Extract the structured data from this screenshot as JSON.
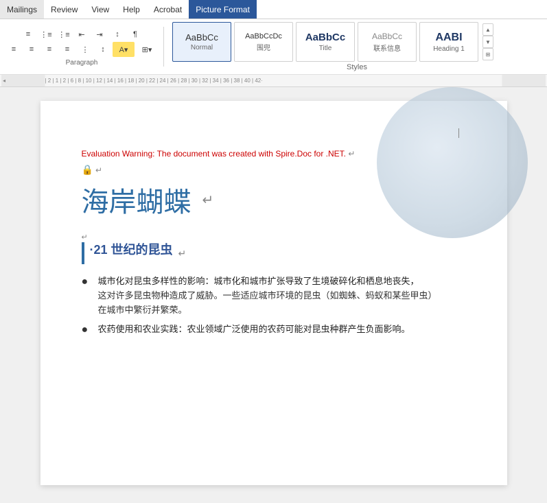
{
  "menu": {
    "items": [
      "Mailings",
      "Review",
      "View",
      "Help",
      "Acrobat",
      "Picture Format"
    ]
  },
  "toolbar": {
    "paragraph_label": "Paragraph",
    "styles_label": "Styles",
    "styles": [
      {
        "id": "normal",
        "preview": "AaBbCc",
        "label": "Normal",
        "active": true
      },
      {
        "id": "weijie",
        "preview": "AaBbCcDc",
        "label": "围兜",
        "active": false
      },
      {
        "id": "title",
        "preview": "AaBbCc",
        "label": "Title",
        "active": false
      },
      {
        "id": "lianjie",
        "preview": "AaBbCc",
        "label": "联系信息",
        "active": false
      },
      {
        "id": "heading1",
        "preview": "AABI",
        "label": "Heading 1",
        "active": false
      }
    ]
  },
  "ruler": {
    "ticks": [
      "-4",
      "·",
      "·",
      "·",
      "2",
      "·",
      "·",
      "·",
      "1",
      "·",
      "·",
      "·",
      "2",
      "·",
      "·",
      "·",
      "6",
      "·",
      "·",
      "·",
      "8",
      "·",
      "·",
      "·",
      "10",
      "·",
      "·",
      "·",
      "12",
      "·",
      "·",
      "·",
      "14",
      "·",
      "·",
      "·",
      "16",
      "·",
      "·",
      "·",
      "18",
      "·",
      "·",
      "·",
      "20",
      "·",
      "·",
      "·",
      "22",
      "·",
      "·",
      "·",
      "24",
      "·",
      "·",
      "·",
      "26",
      "·",
      "·",
      "·",
      "28",
      "·",
      "·",
      "·",
      "30",
      "·",
      "·",
      "·",
      "32",
      "·",
      "·",
      "·",
      "34",
      "·",
      "·",
      "·",
      "36",
      "·",
      "·",
      "·",
      "38",
      "·",
      "·",
      "·",
      "40",
      "·",
      "·",
      "·",
      "42·"
    ]
  },
  "document": {
    "eval_warning": "Evaluation Warning: The document was created with Spire.Doc for .NET.",
    "title": "海岸蝴蝶",
    "section_heading": "·21 世纪的昆虫",
    "bullet_items": [
      {
        "main": "城市化对昆虫多样性的影响：城市化和城市扩张导致了生境破碎化和栖息地丧失，",
        "sub1": "这对许多昆虫物种造成了威胁。一些适应城市环境的昆虫（如蜘蛛、蚂蚁和某些甲虫）",
        "sub2": "在城市中繁衍并繁荣。"
      },
      {
        "main": "农药使用和农业实践：农业领域广泛使用的农药可能对昆虫种群产生负面影响。",
        "sub1": ""
      }
    ]
  }
}
